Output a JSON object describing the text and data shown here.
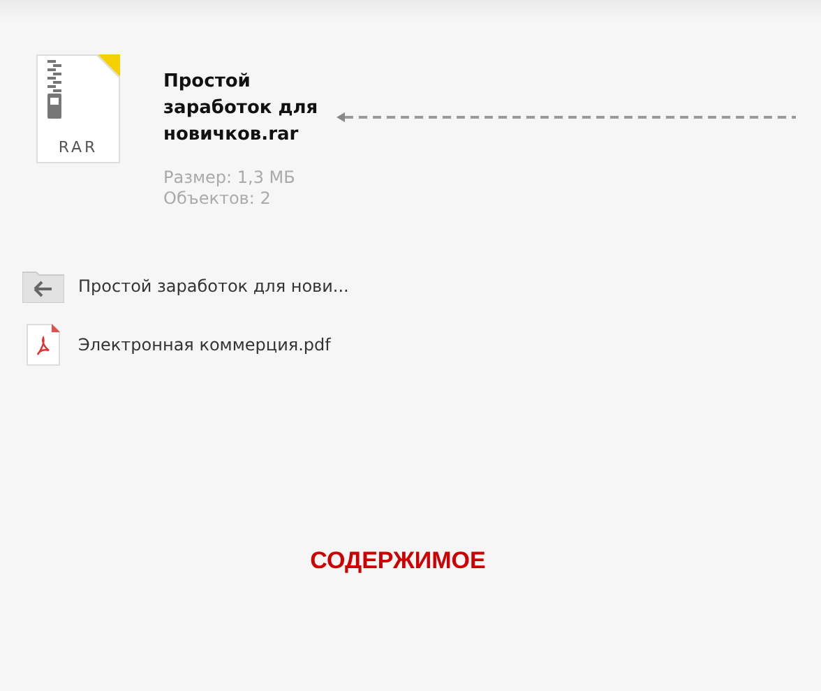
{
  "archive": {
    "type_label": "RAR",
    "name": "Простой заработок для новичков.rar",
    "size": "Размер: 1,3 МБ",
    "count": "Объектов: 2"
  },
  "items": [
    {
      "kind": "back",
      "name": "Простой заработок для нови..."
    },
    {
      "kind": "pdf",
      "name": "Электронная коммерция.pdf"
    }
  ],
  "caption": "СОДЕРЖИМОЕ"
}
